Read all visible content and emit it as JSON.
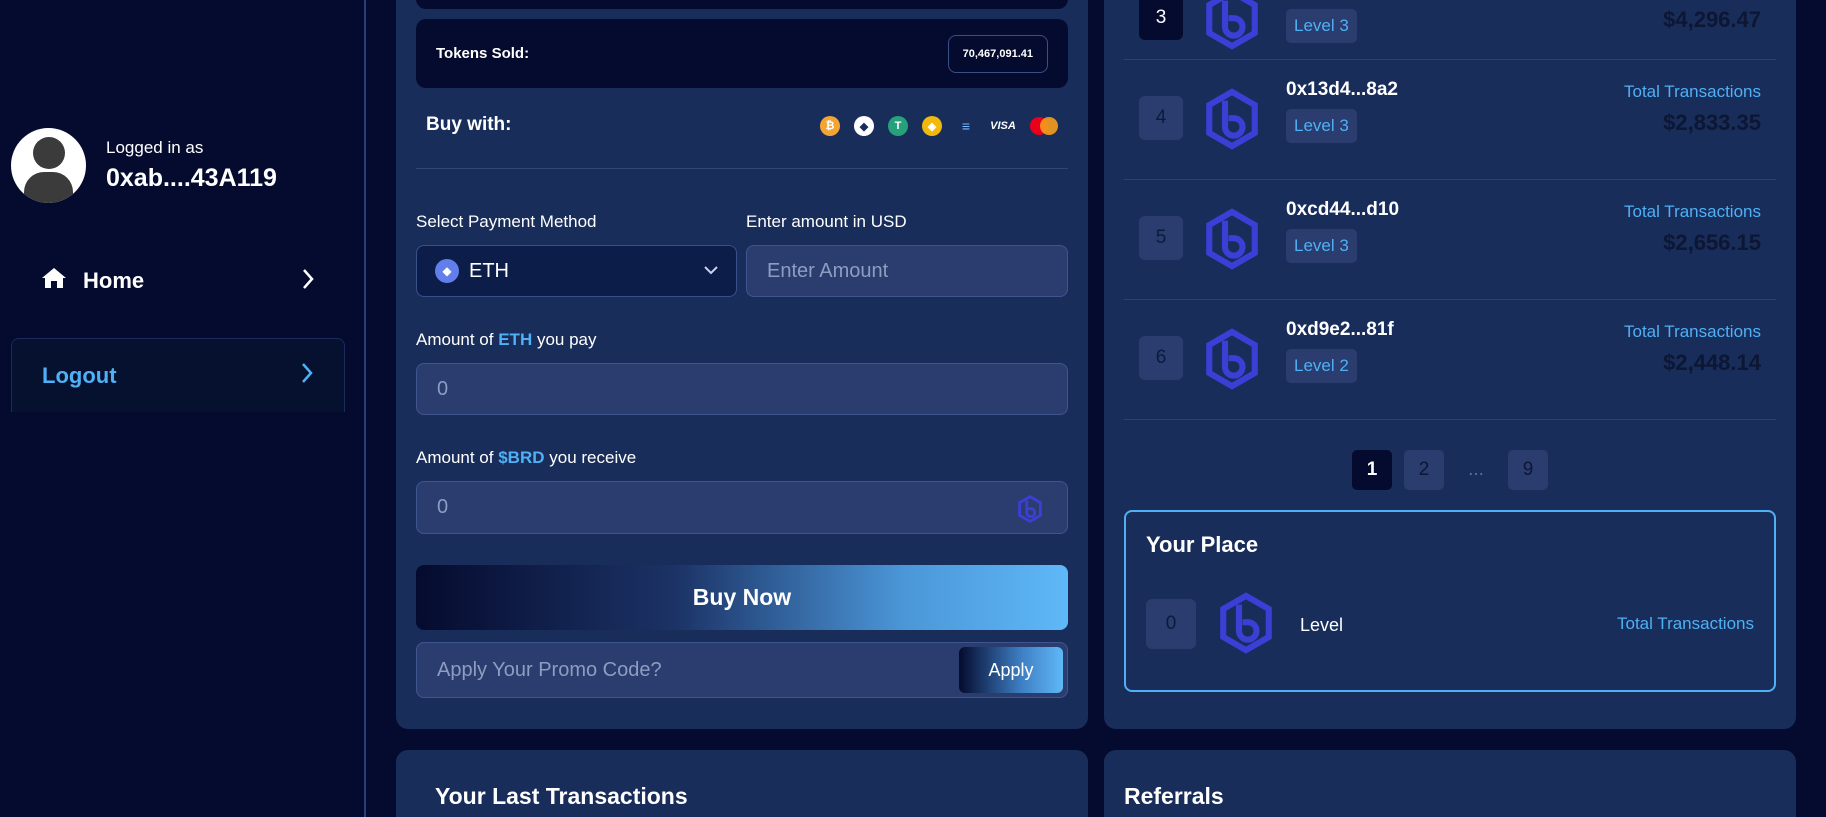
{
  "sidebar": {
    "logged_in_label": "Logged in as",
    "address": "0xab....43A119",
    "nav": [
      {
        "label": "Home",
        "icon": "home-icon"
      },
      {
        "label": "Logout",
        "icon": "logout-icon"
      }
    ]
  },
  "buy": {
    "tokens_sold_label": "Tokens Sold:",
    "tokens_sold_value": "70,467,091.41",
    "buy_with_label": "Buy with:",
    "payment_icons": [
      "bitcoin-icon",
      "ethereum-icon",
      "tether-icon",
      "bnb-icon",
      "solana-icon",
      "visa-icon",
      "mastercard-icon"
    ],
    "visa_text": "VISA",
    "payment_method_label": "Select Payment Method",
    "payment_method_value": "ETH",
    "usd_label": "Enter amount in USD",
    "usd_placeholder": "Enter Amount",
    "pay_label_prefix": "Amount of ",
    "pay_label_token": "ETH",
    "pay_label_suffix": " you pay",
    "pay_value": "0",
    "receive_label_prefix": "Amount of ",
    "receive_label_token": "$BRD",
    "receive_label_suffix": " you receive",
    "receive_value": "0",
    "buy_button": "Buy Now",
    "promo_placeholder": "Apply Your Promo Code?",
    "apply_button": "Apply"
  },
  "leaderboard": {
    "rows": [
      {
        "rank": "3",
        "address": "",
        "level": "Level 3",
        "total_label": "",
        "amount": "$4,296.47"
      },
      {
        "rank": "4",
        "address": "0x13d4...8a2",
        "level": "Level 3",
        "total_label": "Total Transactions",
        "amount": "$2,833.35"
      },
      {
        "rank": "5",
        "address": "0xcd44...d10",
        "level": "Level 3",
        "total_label": "Total Transactions",
        "amount": "$2,656.15"
      },
      {
        "rank": "6",
        "address": "0xd9e2...81f",
        "level": "Level 2",
        "total_label": "Total Transactions",
        "amount": "$2,448.14"
      }
    ],
    "pages": [
      "1",
      "2",
      "...",
      "9"
    ],
    "active_page": "1",
    "your_place": {
      "title": "Your Place",
      "rank": "0",
      "level_label": "Level",
      "total_label": "Total Transactions"
    }
  },
  "transactions": {
    "title": "Your Last Transactions"
  },
  "referrals": {
    "title": "Referrals"
  },
  "colors": {
    "background": "#050b2e",
    "card": "#182d5a",
    "accent": "#4fb0f5",
    "logo": "#3b3fd6"
  }
}
